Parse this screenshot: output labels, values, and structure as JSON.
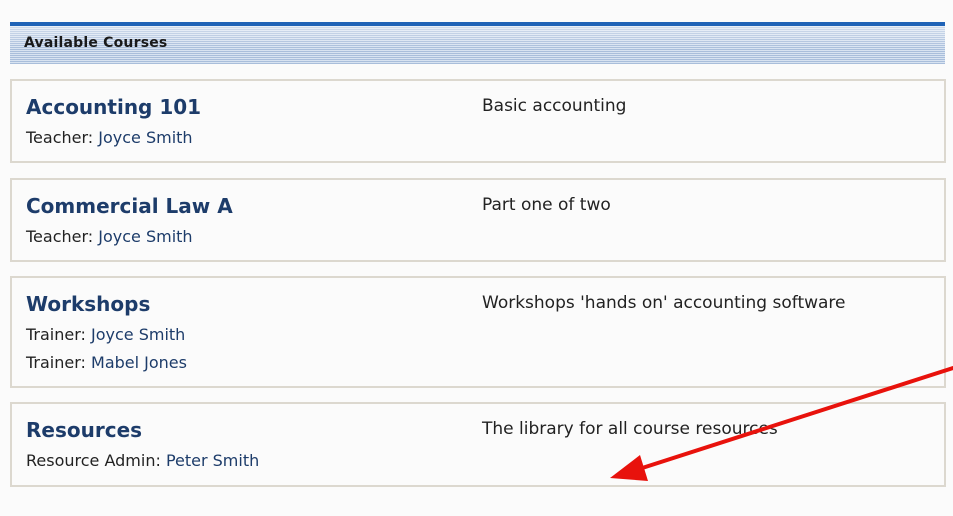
{
  "block": {
    "title": "Available Courses"
  },
  "courses": [
    {
      "name": "Accounting 101",
      "staff": [
        {
          "role": "Teacher:",
          "person": "Joyce Smith"
        }
      ],
      "summary": "Basic accounting"
    },
    {
      "name": "Commercial Law A",
      "staff": [
        {
          "role": "Teacher:",
          "person": "Joyce Smith"
        }
      ],
      "summary": "Part one of two"
    },
    {
      "name": "Workshops",
      "staff": [
        {
          "role": "Trainer:",
          "person": "Joyce Smith"
        },
        {
          "role": "Trainer:",
          "person": "Mabel Jones"
        }
      ],
      "summary": "Workshops 'hands on' accounting software"
    },
    {
      "name": "Resources",
      "staff": [
        {
          "role": "Resource Admin:",
          "person": "Peter Smith"
        }
      ],
      "summary": "The library for all course resources"
    }
  ],
  "colors": {
    "header_border": "#1f63b7",
    "course_link": "#1d3c6a",
    "box_border": "#dcd8cf",
    "annotation_arrow": "#e8120c"
  },
  "annotation": {
    "icon": "red-arrow-icon"
  }
}
